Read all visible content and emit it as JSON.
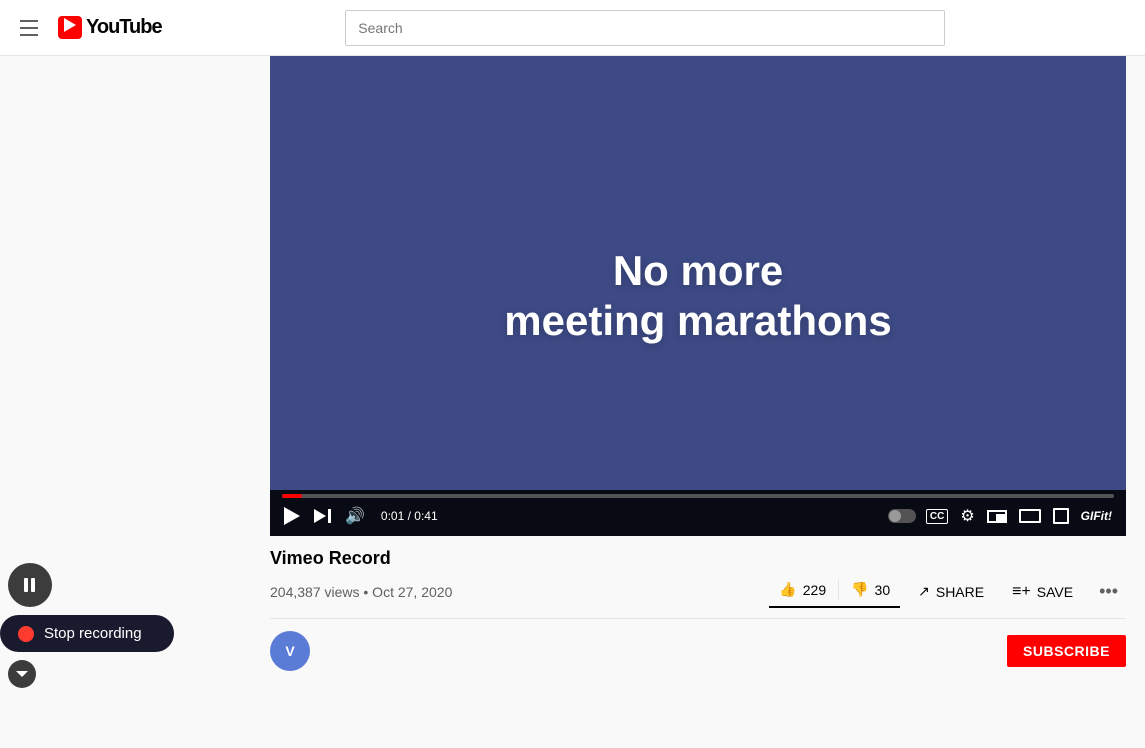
{
  "header": {
    "search_placeholder": "Search",
    "youtube_text": "YouTube"
  },
  "video": {
    "overlay_line1": "No more",
    "overlay_line2": "meeting marathons",
    "progress_percent": 2.4,
    "time_current": "0:01",
    "time_total": "0:41",
    "time_display": "0:01 / 0:41",
    "title": "Vimeo Record",
    "stats": "204,387 views • Oct 27, 2020",
    "like_count": "229",
    "dislike_count": "30",
    "share_label": "SHARE",
    "save_label": "SAVE"
  },
  "channel": {
    "avatar_initials": "V",
    "subscribe_label": "SUBSCRIBE"
  },
  "recording": {
    "stop_label": "Stop recording",
    "pause_title": "Pause",
    "chevron_title": "Collapse"
  }
}
